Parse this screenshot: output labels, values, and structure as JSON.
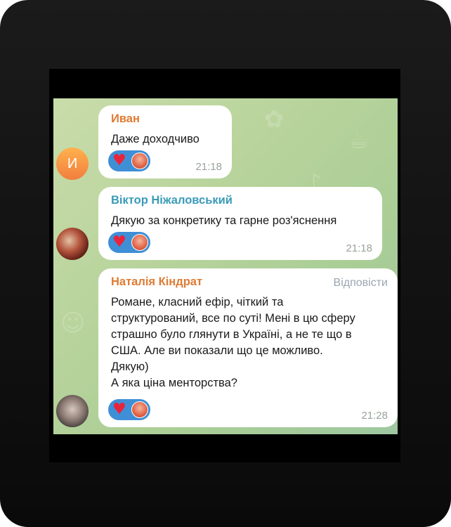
{
  "messages": [
    {
      "sender": "Иван",
      "sender_color": "#e07b33",
      "text": "Даже доходчиво",
      "time": "21:18",
      "avatar_letter": "И",
      "reaction_icon": "heart-icon"
    },
    {
      "sender": "Віктор Ніжаловський",
      "sender_color": "#3a9bb8",
      "text": "Дякую за конкретику та гарне роз'яснення",
      "time": "21:18",
      "reaction_icon": "heart-icon"
    },
    {
      "sender": "Наталія Кіндрат",
      "sender_color": "#e07b33",
      "reply_label": "Відповісти",
      "text": "Романе, класний ефір, чіткий та\nструктурований, все по суті! Мені в цю сферу\nстрашно було глянути в Україні, а не те що в\nСША. Але ви показали що це можливо.\nДякую)\nА яка ціна менторства?",
      "time": "21:28",
      "reaction_icon": "heart-icon"
    }
  ]
}
